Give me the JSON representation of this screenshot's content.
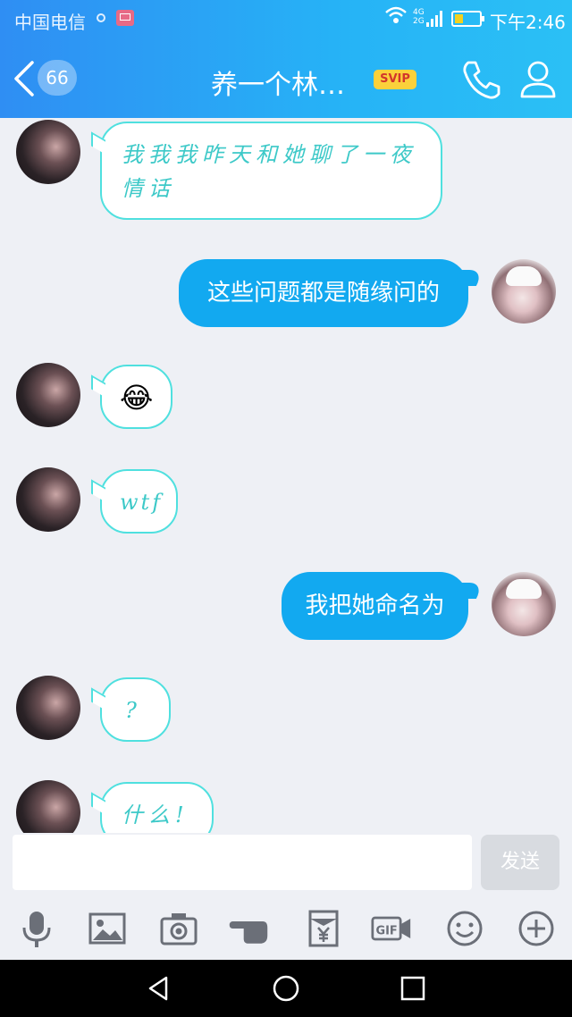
{
  "status_bar": {
    "carrier": "中国电信",
    "network_top": "4G",
    "network_bottom": "2G",
    "time": "下午2:46"
  },
  "header": {
    "unread_count": "66",
    "title": "养一个林…",
    "vip_badge": "SVIP"
  },
  "messages": [
    {
      "side": "other",
      "kind": "text",
      "text": "我我我昨天和她聊了一夜情话"
    },
    {
      "side": "self",
      "kind": "text",
      "text": "这些问题都是随缘问的"
    },
    {
      "side": "other",
      "kind": "emoji",
      "text": "😂"
    },
    {
      "side": "other",
      "kind": "text",
      "text": "wtf"
    },
    {
      "side": "self",
      "kind": "text",
      "text": "我把她命名为"
    },
    {
      "side": "other",
      "kind": "text",
      "text": "?"
    },
    {
      "side": "other",
      "kind": "text",
      "text": "什么!"
    }
  ],
  "composer": {
    "input_value": "",
    "send_label": "发送"
  },
  "toolbar_icons": [
    "microphone-icon",
    "image-icon",
    "camera-icon",
    "poke-hand-icon",
    "red-packet-icon",
    "gif-icon",
    "emoji-icon",
    "plus-icon"
  ],
  "colors": {
    "header_start": "#2f8ef3",
    "header_end": "#2bc0f5",
    "self_bubble": "#12a9f0",
    "other_bubble_border": "#4fe0df",
    "background": "#eef0f5"
  }
}
